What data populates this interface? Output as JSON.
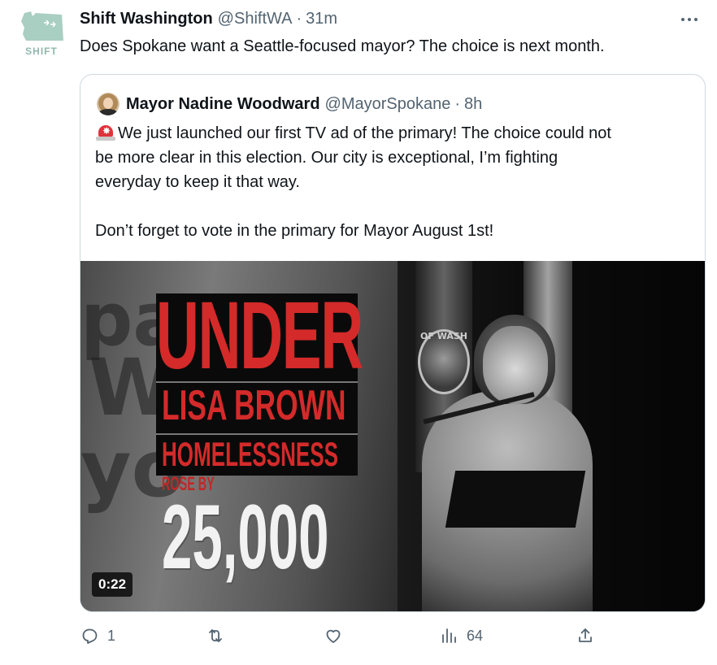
{
  "tweet": {
    "avatar_text": "SHIFT",
    "author_name": "Shift Washington",
    "author_handle": "@ShiftWA",
    "separator": "·",
    "time": "31m",
    "text": "Does Spokane want a Seattle-focused mayor? The choice is next month."
  },
  "quoted_tweet": {
    "author_name": "Mayor Nadine Woodward",
    "author_handle": "@MayorSpokane",
    "separator": "·",
    "time": "8h",
    "line1": "We just launched our first TV ad of the primary! The choice could not",
    "line2": "be more clear in this election. Our city is exceptional, I’m fighting",
    "line3": "everyday to keep it that way.",
    "line4": "Don’t forget to vote in the primary for Mayor August 1st!",
    "siren_icon": "rotating-light-icon"
  },
  "video": {
    "overlay_under": "UNDER",
    "overlay_lisa": "LISA BROWN",
    "overlay_homeless": "HOMELESSNESS",
    "overlay_rose": "ROSE BY",
    "overlay_number": "25,000",
    "background_text_1": "pa",
    "background_text_2": "W",
    "background_text_3": "yo",
    "flag_seal_text": "OF WASH",
    "duration": "0:22"
  },
  "actions": {
    "reply_count": "1",
    "retweet_count": "",
    "like_count": "",
    "views_count": "64"
  },
  "colors": {
    "text_primary": "#0f1419",
    "text_secondary": "#536471",
    "border": "#cfd9de",
    "overlay_red": "#d42a2a"
  }
}
